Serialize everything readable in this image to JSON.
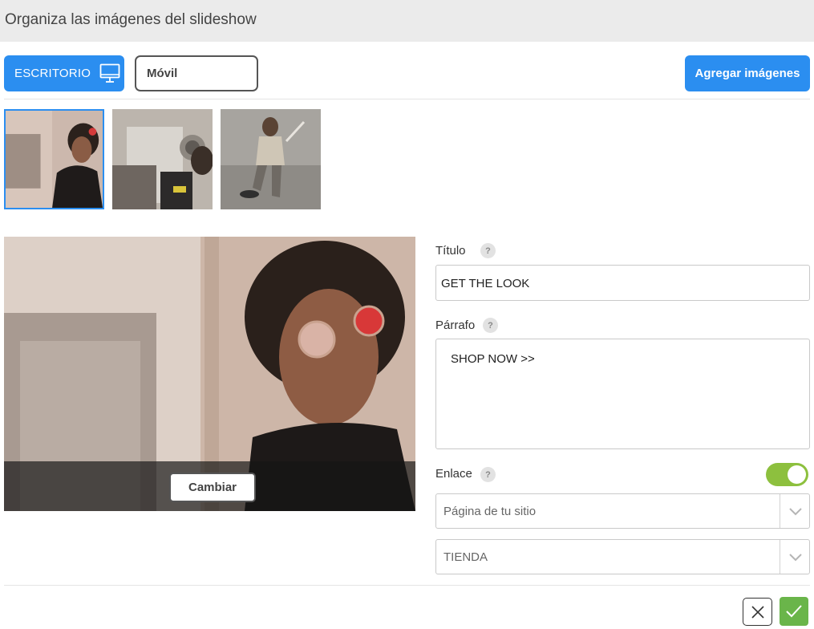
{
  "header": {
    "title": "Organiza las imágenes del slideshow"
  },
  "toolbar": {
    "desktop_label": "ESCRITORIO",
    "desktop_icon": "monitor-icon",
    "mobile_label": "Móvil",
    "add_images_label": "Agregar imágenes"
  },
  "thumbnails": [
    {
      "name": "thumbnail-1",
      "selected": true
    },
    {
      "name": "thumbnail-2",
      "selected": false
    },
    {
      "name": "thumbnail-3",
      "selected": false
    }
  ],
  "preview": {
    "change_label": "Cambiar"
  },
  "form": {
    "title_label": "Título",
    "title_value": "GET THE LOOK",
    "paragraph_label": "Párrafo",
    "paragraph_value": "SHOP NOW >>",
    "link_label": "Enlace",
    "help_glyph": "?",
    "link_enabled": true,
    "link_type": "Página de tu sitio",
    "link_target": "TIENDA"
  },
  "footer": {
    "cancel_icon": "close-icon",
    "confirm_icon": "check-icon"
  },
  "colors": {
    "accent": "#2b8ef0",
    "toggle_on": "#8dc03e",
    "confirm": "#6ab54a",
    "header_bg": "#ebebeb"
  }
}
